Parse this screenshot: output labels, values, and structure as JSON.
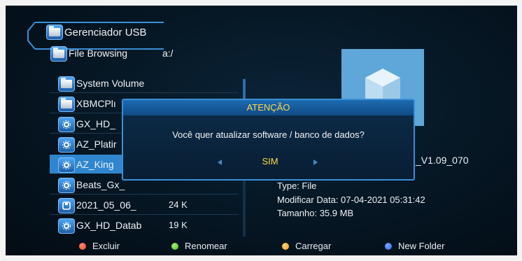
{
  "header": {
    "title": "Gerenciador USB"
  },
  "path": {
    "label": "File Browsing",
    "value": "a:/"
  },
  "files": [
    {
      "name": "System Volume",
      "size": "",
      "icon": "folder-icon"
    },
    {
      "name": "XBMCPlı",
      "size": "",
      "icon": "folder-icon"
    },
    {
      "name": "GX_HD_",
      "size": "",
      "icon": "settings-file-icon"
    },
    {
      "name": "AZ_Platir",
      "size": "",
      "icon": "settings-file-icon"
    },
    {
      "name": "AZ_King",
      "size": "",
      "icon": "settings-file-icon"
    },
    {
      "name": "Beats_Gx_",
      "size": "",
      "icon": "settings-file-icon"
    },
    {
      "name": "2021_05_06_",
      "size": "24 K",
      "icon": "disk-file-icon"
    },
    {
      "name": "GX_HD_Datab",
      "size": "19 K",
      "icon": "settings-file-icon"
    }
  ],
  "selected_file": "AZ_King",
  "details": {
    "version": "_V1.09_070",
    "type": "Type: File",
    "modified": "Modificar Data: 07-04-2021 05:31:42",
    "size": "Tamanho: 35.9 MB"
  },
  "dialog": {
    "title": "ATENÇÃO",
    "message": "Você quer atualizar software / banco de dados?",
    "confirm": "SIM"
  },
  "footer": [
    {
      "label": "Excluir",
      "color": "#e84a28"
    },
    {
      "label": "Renomear",
      "color": "#4fbf2a"
    },
    {
      "label": "Carregar",
      "color": "#f0a020"
    },
    {
      "label": "New Folder",
      "color": "#2a6ae8"
    }
  ],
  "colors": {
    "accent": "#2f86cf",
    "dialog_title": "#ffd84a"
  }
}
